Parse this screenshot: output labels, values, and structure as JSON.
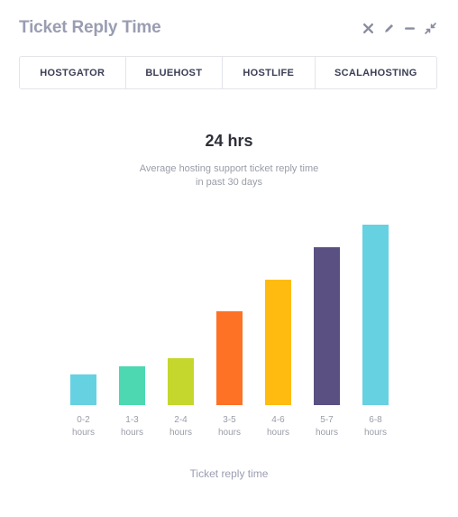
{
  "widget": {
    "title": "Ticket Reply Time",
    "tabs": [
      {
        "label": "HOSTGATOR"
      },
      {
        "label": "BLUEHOST"
      },
      {
        "label": "HOSTLIFE"
      },
      {
        "label": "SCALAHOSTING"
      }
    ],
    "headline": "24 hrs",
    "subtitle_line1": "Average hosting support ticket reply time",
    "subtitle_line2": "in past 30 days",
    "icons": [
      "close-icon",
      "edit-icon",
      "minimize-icon",
      "collapse-icon"
    ]
  },
  "chart_data": {
    "type": "bar",
    "xlabel": "Ticket reply time",
    "ylabel": "",
    "categories": [
      [
        "0-2",
        "hours"
      ],
      [
        "1-3",
        "hours"
      ],
      [
        "2-4",
        "hours"
      ],
      [
        "3-5",
        "hours"
      ],
      [
        "4-6",
        "hours"
      ],
      [
        "5-7",
        "hours"
      ],
      [
        "6-8",
        "hours"
      ]
    ],
    "values": [
      17,
      21.5,
      26,
      52,
      69.5,
      87.5,
      100
    ],
    "colors": [
      "#66d1e0",
      "#4dd8b1",
      "#c5d72c",
      "#fd7225",
      "#ffbb10",
      "#5a5082",
      "#66d1e0"
    ],
    "grid": false,
    "legend": "none"
  }
}
